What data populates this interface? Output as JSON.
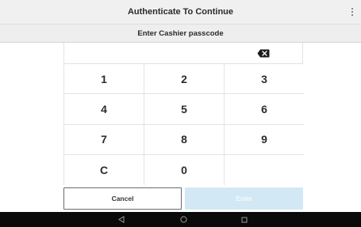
{
  "header": {
    "title": "Authenticate To Continue",
    "menu_icon": "more-vertical-icon"
  },
  "prompt": {
    "label": "Enter Cashier passcode"
  },
  "passcode": {
    "value": "",
    "backspace_icon": "backspace-icon"
  },
  "keypad": {
    "keys": [
      "1",
      "2",
      "3",
      "4",
      "5",
      "6",
      "7",
      "8",
      "9",
      "C",
      "0",
      ""
    ]
  },
  "actions": {
    "cancel_label": "Cancel",
    "enter_label": "Enter",
    "enter_color": "#d3e8f5"
  },
  "system_nav": {
    "back_icon": "back-triangle-icon",
    "home_icon": "home-circle-icon",
    "recent_icon": "recent-apps-square-icon"
  }
}
